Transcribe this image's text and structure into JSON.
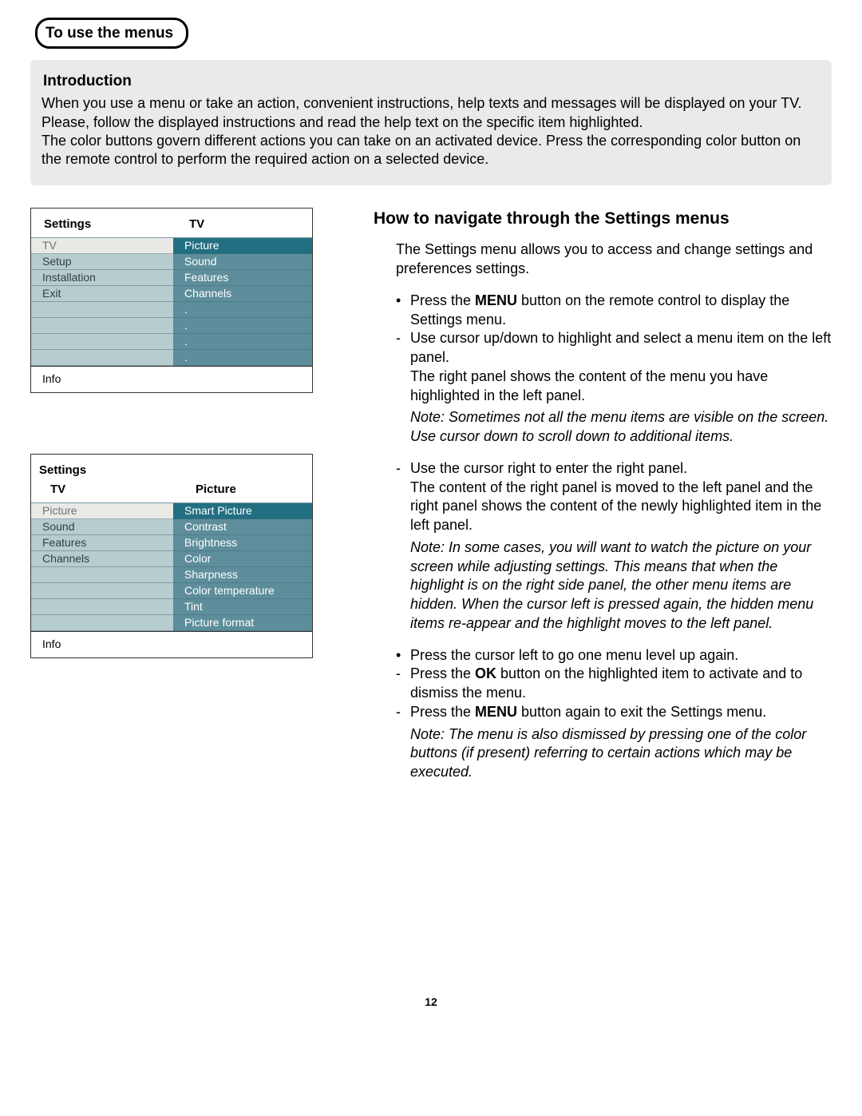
{
  "tab_title": "To use the menus",
  "intro": {
    "heading": "Introduction",
    "p1": "When you use a menu or take an action, convenient instructions, help texts and messages will be displayed on your TV. Please, follow the displayed instructions and read the help text on the specific item highlighted.",
    "p2": "The color buttons govern different actions you can take on an activated device. Press the corresponding color button on the remote control to perform the required action on a selected device."
  },
  "fig1": {
    "head_left": "Settings",
    "head_right": "TV",
    "left": [
      "TV",
      "Setup",
      "Installation",
      "Exit",
      "",
      "",
      "",
      ""
    ],
    "right": [
      "Picture",
      "Sound",
      "Features",
      "Channels",
      "",
      "",
      "",
      ""
    ],
    "footer": "Info"
  },
  "fig2": {
    "head_left": "Settings",
    "head_right": "",
    "sub_left": "TV",
    "sub_right": "Picture",
    "left": [
      "Picture",
      "Sound",
      "Features",
      "Channels",
      "",
      "",
      ""
    ],
    "right": [
      "Smart Picture",
      "Contrast",
      "Brightness",
      "Color",
      "Sharpness",
      "Color temperature",
      "Tint",
      "Picture format"
    ],
    "footer": "Info"
  },
  "right": {
    "title": "How to navigate through the Settings menus",
    "p1": "The Settings menu allows you to access and change settings and preferences settings.",
    "b1a": "Press the ",
    "b1b": "MENU",
    "b1c": " button on the remote control to display the Settings menu.",
    "b2": "Use cursor up/down to highlight and select a menu item on the left panel.",
    "p2": "The right panel shows the content of the  menu you have highlighted in the left panel.",
    "n1": "Note: Sometimes not all the menu items are visible on the screen. Use cursor down to scroll down to additional items.",
    "b3": "Use the cursor right to enter the right panel.",
    "p3": "The content of the right panel is moved to the left panel and the right panel shows the content of the newly highlighted item in the left panel.",
    "n2": "Note: In some cases, you will want to watch the picture on your screen while adjusting settings. This means that when the highlight is on the right side panel, the other menu items are hidden. When the cursor left is pressed again, the hidden menu items re-appear and the highlight moves to the left panel.",
    "b4": "Press the cursor left to go one menu level up again.",
    "b5a": "Press the ",
    "b5b": "OK",
    "b5c": " button on the highlighted item to activate and to dismiss the menu.",
    "b6a": "Press the ",
    "b6b": "MENU",
    "b6c": " button again to exit the Settings menu.",
    "n3": "Note: The menu is also dismissed by pressing one of the color buttons (if present) referring to certain actions which may be executed."
  },
  "pagenum": "12"
}
